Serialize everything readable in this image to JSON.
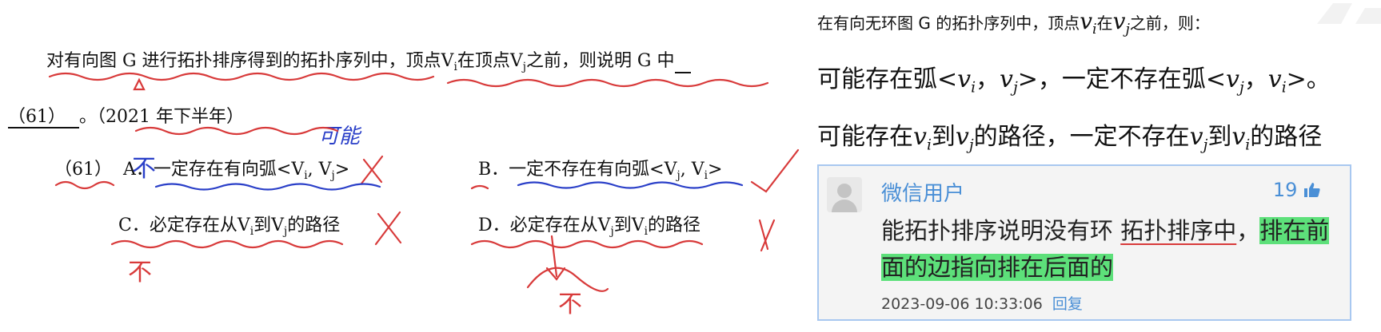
{
  "question": {
    "stem_a": "对有向图 G 进行拓扑排序得到的拓扑序列中，顶点V",
    "sub_i": "i",
    "stem_b": "在顶点V",
    "sub_j": "j",
    "stem_c": "之前，则说明 G 中",
    "blank_label": "（61）",
    "year": "。（2021 年下半年）",
    "num": "（61）",
    "opt_a_letter": "A．",
    "opt_a_text": "一定存在有向弧<V",
    "opt_b_letter": "B．",
    "opt_b_text": "一定不存在有向弧<V",
    "opt_c_letter": "C．",
    "opt_c_text": "必定存在从V",
    "opt_d_letter": "D．",
    "opt_d_text": "必定存在从V",
    "to": "到V",
    "path_suffix": "的路径",
    "comma_v": ", V",
    "close": ">"
  },
  "handwriting": {
    "a_note": "可能",
    "not": "不",
    "not_c": "不"
  },
  "right_note": {
    "line1_a": "在有向无环图 G 的拓扑序列中，顶点",
    "line1_b": "在",
    "line1_c": "之前，则：",
    "line2_a": "可能存在弧<",
    "line2_b": ">，一定不存在弧<",
    "line2_c": ">。",
    "line3_a": "可能存在",
    "line3_b": "到",
    "line3_c": "的路径，一定不存在",
    "line3_d": "的路径",
    "vi": "v",
    "sub_i": "i",
    "sub_j": "j",
    "comma": "，"
  },
  "comment": {
    "username": "微信用户",
    "likes": "19",
    "like_icon": "thumbs-up-icon",
    "text_plain": "能拓扑排序说明没有环 ",
    "text_underlined": "拓扑排序中",
    "text_sep": "，",
    "text_highlight": "排在前面的边指向排在后面的",
    "timestamp": "2023-09-06 10:33:06",
    "reply": "回复"
  }
}
